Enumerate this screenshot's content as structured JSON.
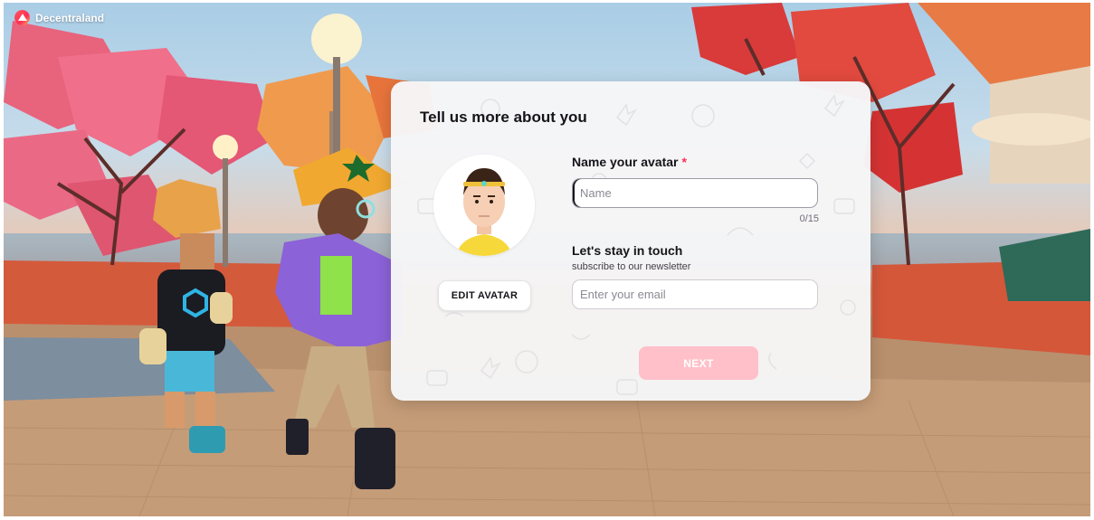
{
  "app": {
    "name": "Decentraland",
    "logo_icon": "decentraland-logo-icon"
  },
  "card": {
    "title": "Tell us more about you",
    "edit_avatar_label": "EDIT AVATAR",
    "name_field": {
      "label": "Name your avatar",
      "required_mark": "*",
      "placeholder": "Name",
      "value": "",
      "counter": "0/15"
    },
    "newsletter": {
      "label": "Let's stay in touch",
      "sublabel": "subscribe to our newsletter",
      "placeholder": "Enter your email",
      "value": ""
    },
    "next_label": "NEXT"
  },
  "colors": {
    "accent": "#ff2d55",
    "next_disabled": "#ffc0c9",
    "card_bg": "#f6f6f7",
    "text": "#16141a"
  }
}
